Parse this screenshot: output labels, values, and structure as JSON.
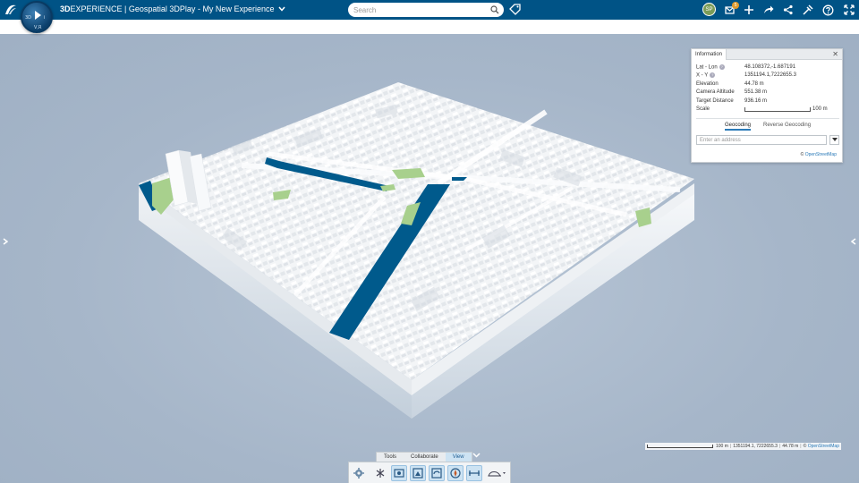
{
  "app": {
    "brand_bold": "3D",
    "brand_rest": "EXPERIENCE",
    "separator": " | ",
    "app_name": "Geospatial 3DPlay",
    "dash": " - ",
    "title": "My New Experience",
    "compass_labels": {
      "top": "",
      "left": "3D",
      "right": "i",
      "bottom": "V,R"
    }
  },
  "search": {
    "placeholder": "Search"
  },
  "topbar_icons": [
    "tag-icon",
    "notifications-icon",
    "add-icon",
    "share-icon",
    "social-icon",
    "tools-icon",
    "help-icon",
    "fullscreen-icon"
  ],
  "user": {
    "initials": "SP",
    "notification_count": "5"
  },
  "info_panel": {
    "tab": "Information",
    "rows": [
      {
        "label": "Lat - Lon",
        "value": "48.108372,-1.687191",
        "help": true
      },
      {
        "label": "X - Y",
        "value": "1351194.1,7222655.3",
        "help": true
      },
      {
        "label": "Elevation",
        "value": "44.78 m",
        "help": false
      },
      {
        "label": "Camera Altitude",
        "value": "551.38 m",
        "help": false
      },
      {
        "label": "Target Distance",
        "value": "936.16 m",
        "help": false
      }
    ],
    "scale_label": "Scale",
    "scale_value": "100 m",
    "tabs": [
      "Geocoding",
      "Reverse Geocoding"
    ],
    "address_placeholder": "Enter an address",
    "copyright": "©",
    "osm": "OpenStreetMap"
  },
  "status_bar": {
    "scale": "100 m",
    "coords": "1351194.1, 7222655.3",
    "elevation": "44.78 m",
    "copyright": "©",
    "osm": "OpenStreetMap"
  },
  "action_bar": {
    "tabs": [
      "Tools",
      "Collaborate",
      "View"
    ],
    "active_tab": "View"
  },
  "colors": {
    "topbar": "#005386",
    "water": "#005a8c",
    "park": "#a8d08d",
    "building": "#f4f6f8",
    "background": "#a9b9cc"
  }
}
